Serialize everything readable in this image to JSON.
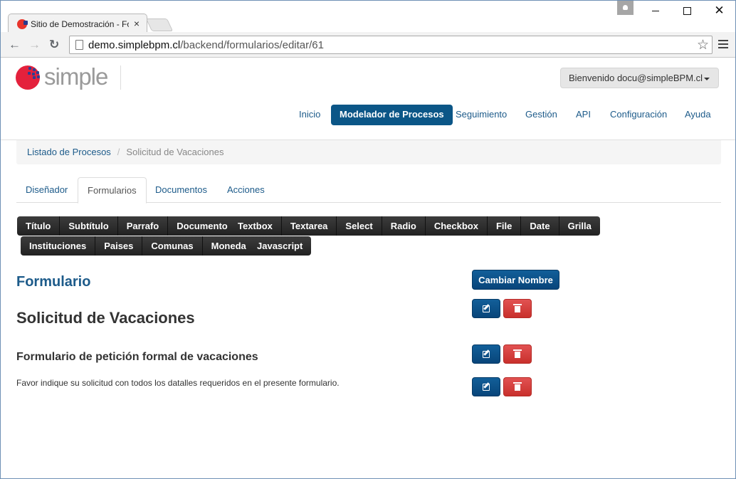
{
  "browser": {
    "tab_title": "Sitio de Demostración - Fo",
    "tab_close": "×",
    "url_host": "demo.simplebpm.cl",
    "url_path": "/backend/formularios/editar/61",
    "window_close": "✕"
  },
  "header": {
    "logo_text": "simple",
    "welcome": "Bienvenido docu@simpleBPM.cl"
  },
  "mainnav": {
    "items": [
      "Inicio",
      "Modelador de Procesos",
      "Seguimiento",
      "Gestión",
      "API",
      "Configuración",
      "Ayuda"
    ],
    "active": "Modelador de Procesos"
  },
  "breadcrumb": {
    "parent": "Listado de Procesos",
    "divider": "/",
    "current": "Solicitud de Vacaciones"
  },
  "tabs": {
    "items": [
      "Diseñador",
      "Formularios",
      "Documentos",
      "Acciones"
    ],
    "active": "Formularios"
  },
  "toolbox": {
    "group1": [
      "Título",
      "Subtítulo",
      "Parrafo",
      "Documento"
    ],
    "group2": [
      "Textbox",
      "Textarea",
      "Select",
      "Radio",
      "Checkbox",
      "File",
      "Date",
      "Grilla"
    ],
    "group3": [
      "Instituciones",
      "Paises",
      "Comunas",
      "Moneda"
    ],
    "group4": [
      "Javascript"
    ]
  },
  "form": {
    "label": "Formulario",
    "change_name": "Cambiar Nombre",
    "fields": [
      {
        "type": "title",
        "text": "Solicitud de Vacaciones"
      },
      {
        "type": "subtitle",
        "text": "Formulario de petición formal de vacaciones"
      },
      {
        "type": "paragraph",
        "text": "Favor indique su solicitud con todos los datalles requeridos en el presente formulario."
      }
    ]
  },
  "colors": {
    "primary": "#0b5687",
    "danger": "#d9534f",
    "dark_button": "#2b2b2b",
    "link": "#1d5b8a"
  }
}
